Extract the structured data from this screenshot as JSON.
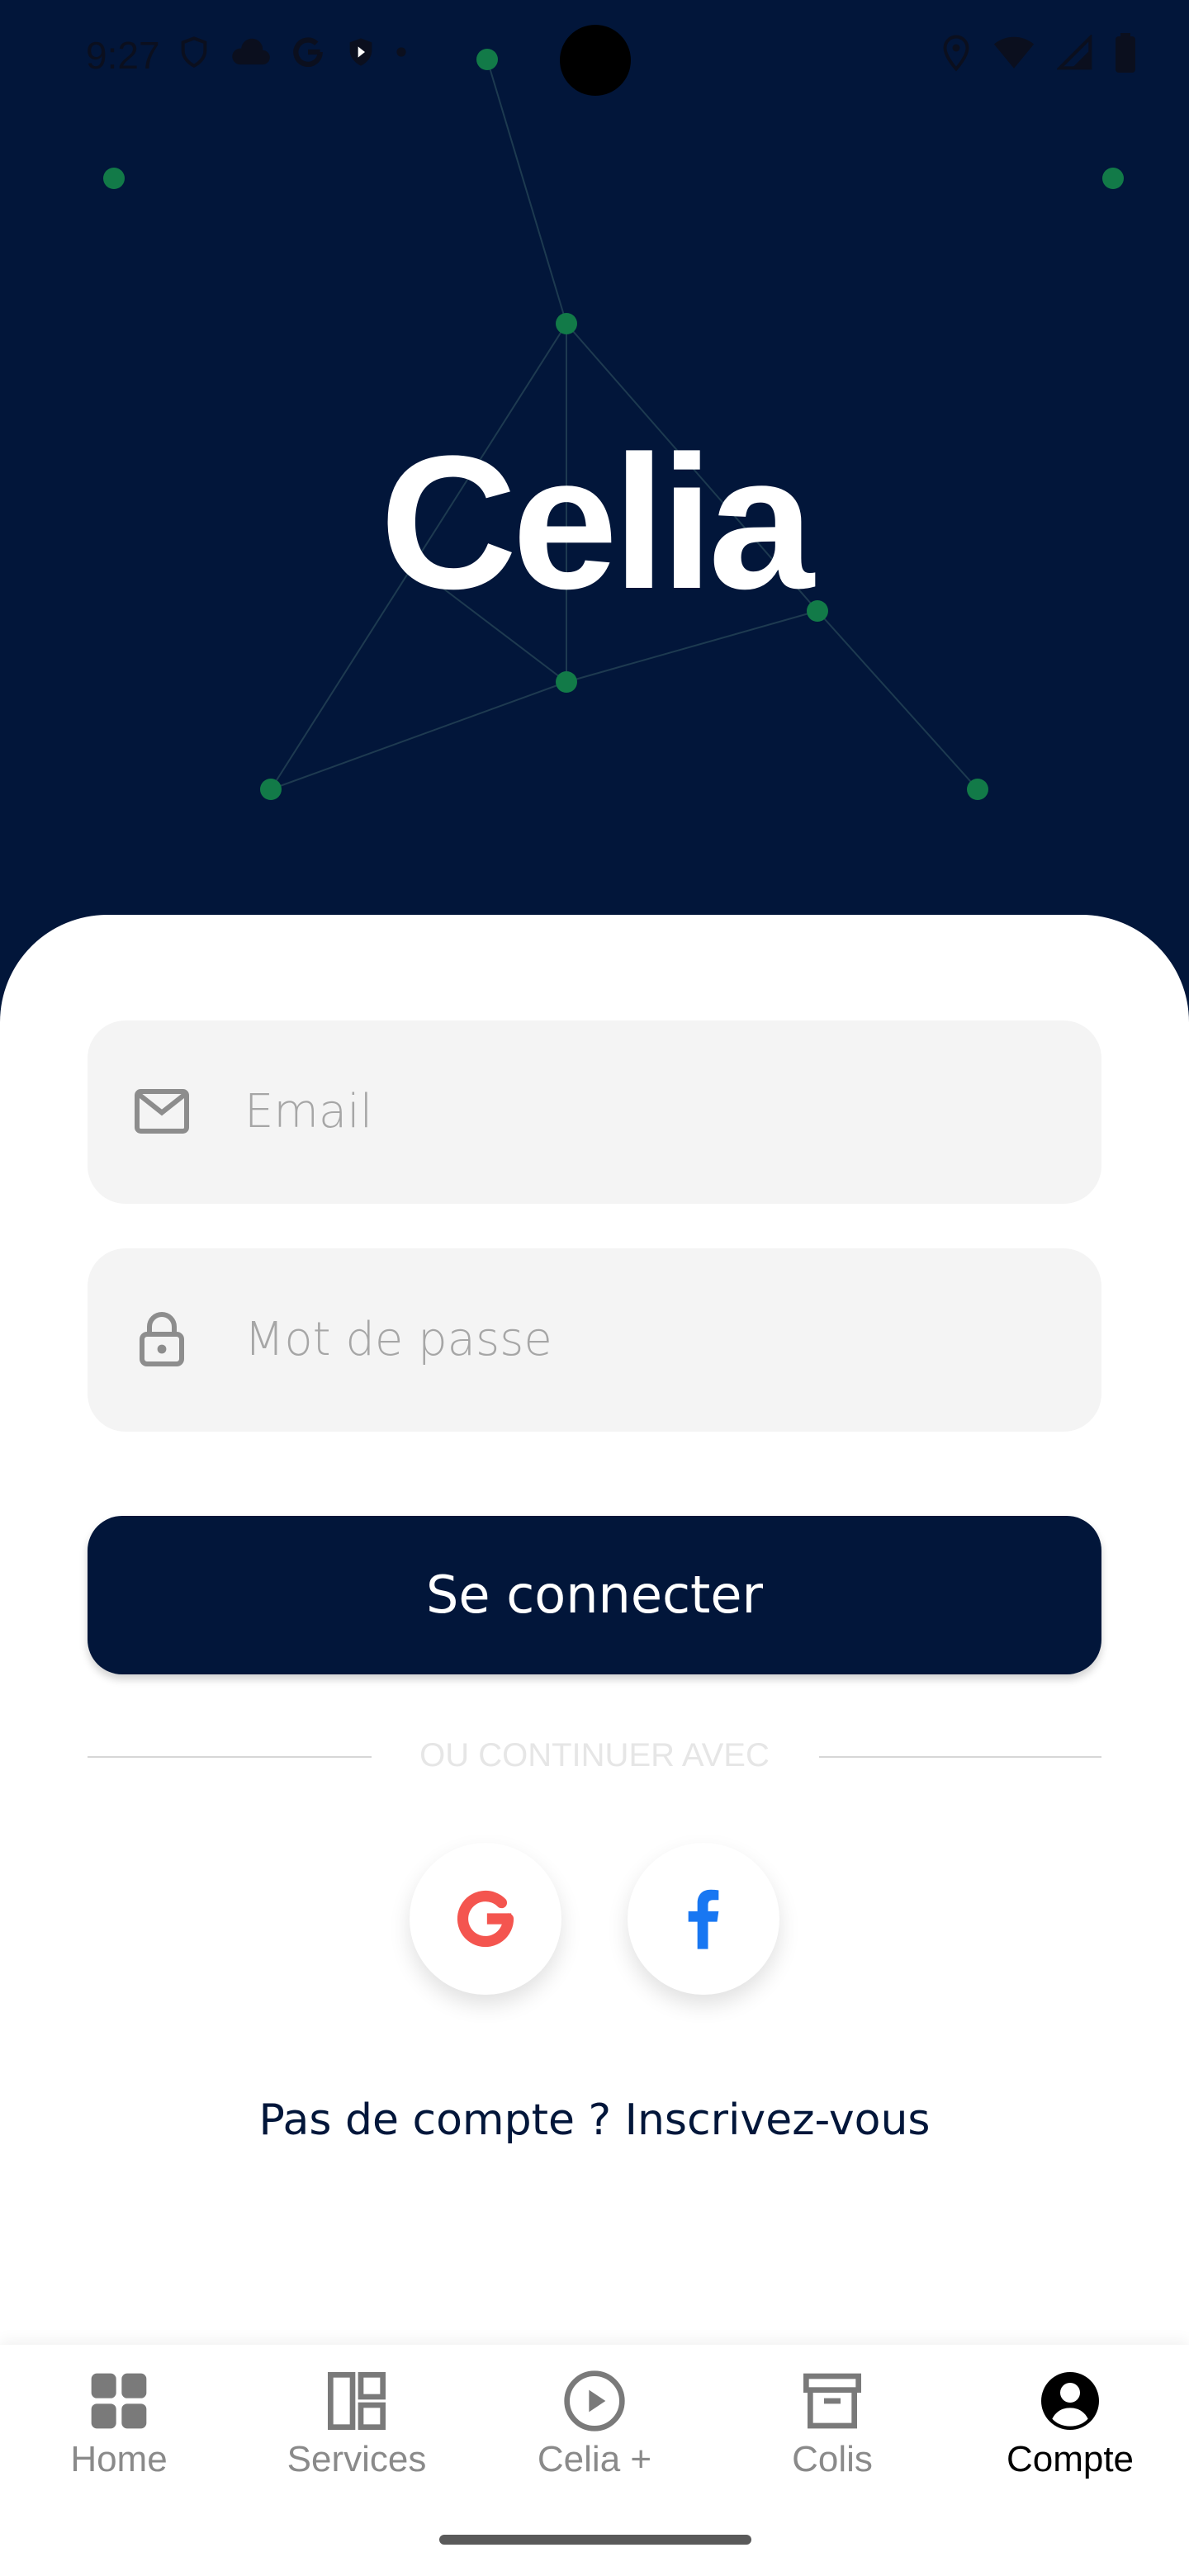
{
  "status_bar": {
    "time": "9:27",
    "left_icons": [
      "shield-icon",
      "cloud-icon",
      "google-icon",
      "vpn-icon",
      "dot-icon"
    ],
    "right_icons": [
      "location-icon",
      "wifi-icon",
      "signal-icon",
      "battery-icon"
    ]
  },
  "hero": {
    "logo_text": "Celia",
    "background_color": "#02163a",
    "node_color": "#1a7a4a"
  },
  "login_form": {
    "email_placeholder": "Email",
    "password_placeholder": "Mot de passe",
    "submit_label": "Se connecter",
    "divider_text": "OU CONTINUER AVEC",
    "social_buttons": [
      {
        "name": "google",
        "icon": "google-icon",
        "color": "#f4554f"
      },
      {
        "name": "facebook",
        "icon": "facebook-icon",
        "color": "#1877f2"
      }
    ],
    "signup_text": "Pas de compte ? Inscrivez-vous"
  },
  "bottom_nav": {
    "items": [
      {
        "label": "Home",
        "icon": "grid-icon",
        "active": false
      },
      {
        "label": "Services",
        "icon": "dashboard-icon",
        "active": false
      },
      {
        "label": "Celia +",
        "icon": "play-circle-icon",
        "active": false
      },
      {
        "label": "Colis",
        "icon": "archive-box-icon",
        "active": false
      },
      {
        "label": "Compte",
        "icon": "account-circle-icon",
        "active": true
      }
    ]
  }
}
